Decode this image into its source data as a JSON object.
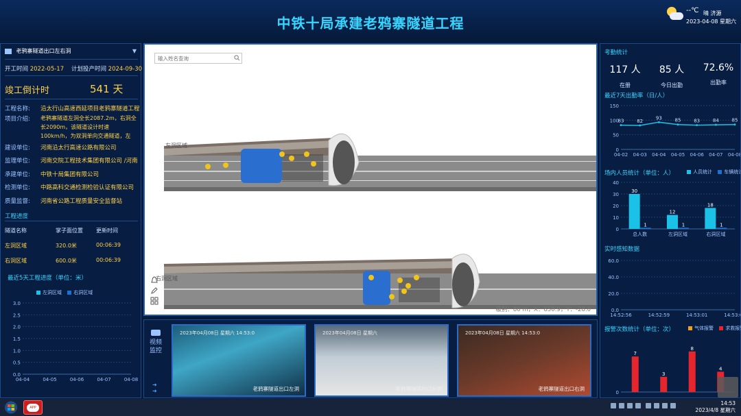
{
  "header": {
    "title": "中铁十局承建老鸦寨隧道工程"
  },
  "weather": {
    "temp": "--℃",
    "desc": "晴 济源",
    "date": "2023-04-08 星期六"
  },
  "left": {
    "project": "老鸦寨隧道出口左右洞",
    "start_label": "开工时间",
    "start_date": "2022-05-17",
    "plan_label": "计划投产时间",
    "plan_date": "2024-09-30",
    "countdown_label": "竣工倒计时",
    "countdown_value": "541 天",
    "info": [
      {
        "k": "工程名称:",
        "v": "沿太行山高速西延项目老鸦寨隧道工程"
      },
      {
        "k": "项目介绍:",
        "v": ""
      },
      {
        "k": "建设单位:",
        "v": "河南沿太行高速公路有限公司"
      },
      {
        "k": "监理单位:",
        "v": "河南交院工程技术集团有限公司 /河南"
      },
      {
        "k": "承建单位:",
        "v": "中铁十局集团有限公司"
      },
      {
        "k": "检测单位:",
        "v": "中路高科交通检测检验认证有限公司"
      },
      {
        "k": "质量监督:",
        "v": "河南省公路工程质量安全监督站"
      }
    ],
    "intro": "老鸦寨隧道左洞全长2087.2m，右洞全长2090m，该隧道设计时速100km/h，为双洞单向交通隧道，左",
    "progress_title": "工程进度",
    "progress_headers": [
      "隧道名称",
      "掌子面位置",
      "更新时间"
    ],
    "progress_rows": [
      [
        "左洞区域",
        "320.0米",
        "00:06:39"
      ],
      [
        "右洞区域",
        "600.0米",
        "00:06:39"
      ]
    ],
    "chart_title": "最近5天工程进度（单位：米）",
    "legend": [
      "左洞区域",
      "右洞区域"
    ]
  },
  "center": {
    "search_placeholder": "输入姓名查询",
    "coord_readout": "级别：80 m，X：850.9，Y：-28.0",
    "left_tunnel": "左洞区域",
    "right_tunnel": "右洞区域"
  },
  "video": {
    "title": "视频监控",
    "feeds": [
      {
        "ts": "2023年04月08日 星期六 14:53:0",
        "caption": "老鸦寨隧道出口左洞"
      },
      {
        "ts": "2023年04月08日 星期六",
        "caption": "老鸦寨隧道出口左洞"
      },
      {
        "ts": "2023年04月08日 星期六 14:53:0",
        "caption": "老鸦寨隧道出口右洞"
      }
    ]
  },
  "right": {
    "attendance_title": "考勤统计",
    "stats": [
      {
        "num": "117 人",
        "label": "在册"
      },
      {
        "num": "85 人",
        "label": "今日出勤"
      },
      {
        "num": "72.6%",
        "label": "出勤率"
      }
    ],
    "rate_title": "最近7天出勤率（日/人）",
    "people_title": "场内人员统计（单位：人）",
    "people_legend": [
      "人员统计",
      "车辆统计"
    ],
    "sensor_title": "实时感知数据",
    "alarm_title": "报警次数统计（单位：次）",
    "alarm_legend": [
      "气体报警",
      "求救报警"
    ]
  },
  "taskbar": {
    "time": "14:53",
    "date": "2023/4/8 星期六"
  },
  "colors": {
    "accent": "#35d6ff",
    "value": "#ffd24a",
    "bar": "#19c2e6",
    "alarm": "#e5262c"
  },
  "chart_data": [
    {
      "type": "line",
      "title": "最近5天工程进度（单位：米）",
      "categories": [
        "04-04",
        "04-05",
        "04-06",
        "04-07",
        "04-08"
      ],
      "series": [
        {
          "name": "左洞区域",
          "values": []
        },
        {
          "name": "右洞区域",
          "values": []
        }
      ],
      "yticks": [
        0,
        0.5,
        1.0,
        1.5,
        2.0,
        2.5,
        3.0
      ],
      "ylim": [
        0,
        3.0
      ]
    },
    {
      "type": "line",
      "title": "最近7天出勤率（日/人）",
      "categories": [
        "04-02",
        "04-03",
        "04-04",
        "04-05",
        "04-06",
        "04-07",
        "04-08"
      ],
      "series": [
        {
          "values": [
            83,
            82,
            93,
            85,
            83,
            84,
            85
          ]
        }
      ],
      "yticks": [
        0,
        50,
        100,
        150
      ],
      "ylim": [
        0,
        150
      ]
    },
    {
      "type": "bar",
      "title": "场内人员统计（单位：人）",
      "categories": [
        "总人数",
        "左洞区域",
        "右洞区域"
      ],
      "series": [
        {
          "name": "人员统计",
          "values": [
            30,
            12,
            18
          ]
        },
        {
          "name": "车辆统计",
          "values": [
            1,
            1,
            1
          ]
        }
      ],
      "yticks": [
        0,
        10,
        20,
        30,
        40
      ],
      "ylim": [
        0,
        40
      ]
    },
    {
      "type": "line",
      "title": "实时感知数据",
      "categories": [
        "14:52:56",
        "14:52:59",
        "14:53:01",
        "14:53:02"
      ],
      "series": [],
      "yticks": [
        0,
        20.0,
        40.0,
        60.0
      ],
      "ylim": [
        0,
        60
      ]
    },
    {
      "type": "bar",
      "title": "报警次数统计（单位：次）",
      "categories": [
        "",
        "",
        "",
        ""
      ],
      "series": [
        {
          "name": "气体报警",
          "values": [
            7,
            3,
            8,
            4
          ]
        },
        {
          "name": "求救报警",
          "values": []
        }
      ],
      "yticks": [
        0
      ],
      "ylim": [
        0,
        10
      ]
    }
  ]
}
